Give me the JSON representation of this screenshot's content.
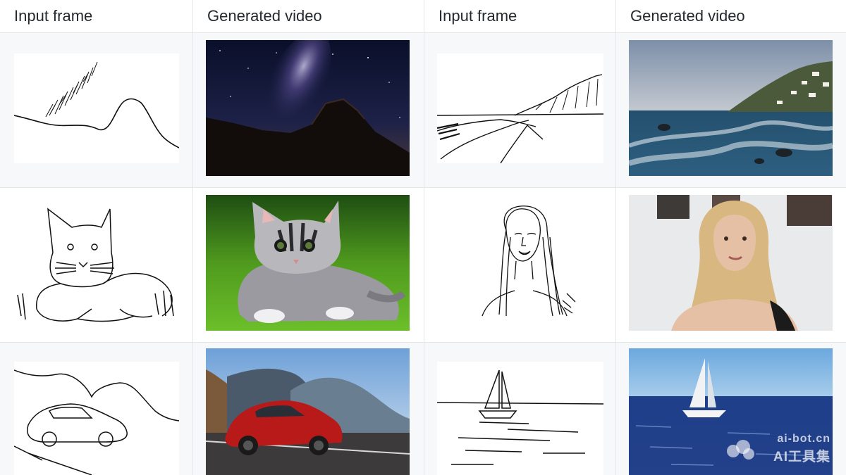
{
  "table": {
    "headers": [
      "Input frame",
      "Generated video",
      "Input frame",
      "Generated video"
    ],
    "rows": [
      [
        {
          "type": "sketch",
          "icon": "mountain-sketch-icon"
        },
        {
          "type": "video",
          "icon": "night-sky-mountain-video-icon"
        },
        {
          "type": "sketch",
          "icon": "coast-sketch-icon"
        },
        {
          "type": "video",
          "icon": "coast-town-video-icon"
        }
      ],
      [
        {
          "type": "sketch",
          "icon": "cat-sketch-icon"
        },
        {
          "type": "video",
          "icon": "cat-on-grass-video-icon"
        },
        {
          "type": "sketch",
          "icon": "woman-sketch-icon"
        },
        {
          "type": "video",
          "icon": "woman-speaking-video-icon"
        }
      ],
      [
        {
          "type": "sketch",
          "icon": "car-sketch-icon"
        },
        {
          "type": "video",
          "icon": "red-car-mountains-video-icon"
        },
        {
          "type": "sketch",
          "icon": "sailboat-sketch-icon"
        },
        {
          "type": "video",
          "icon": "sailboat-sea-video-icon"
        }
      ]
    ]
  },
  "watermark": {
    "domain": "ai-bot.cn",
    "name": "AI工具集"
  },
  "colors": {
    "header_text": "#24292f",
    "border": "#e3e6ea",
    "alt_row": "#f6f8fa"
  }
}
